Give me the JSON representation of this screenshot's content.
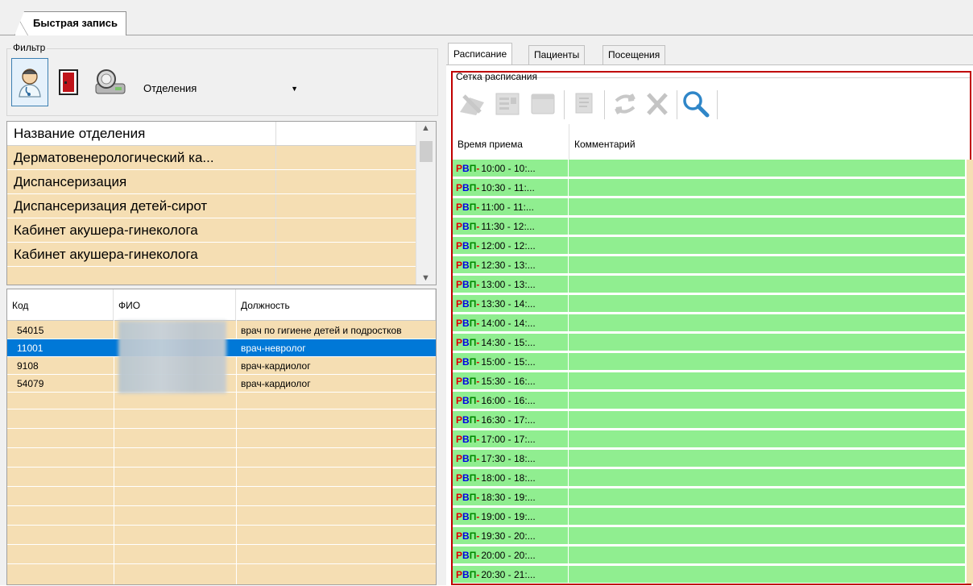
{
  "main_tab": {
    "label": "Быстрая запись"
  },
  "filter": {
    "legend": "Фильтр",
    "select_value": "Отделения",
    "buttons": [
      "doctor-icon",
      "door-icon",
      "scanner-icon"
    ]
  },
  "departments": {
    "header": "Название отделения",
    "rows": [
      "Дерматовенерологический ка...",
      "Диспансеризация",
      "Диспансеризация детей-сирот",
      "Кабинет акушера-гинеколога",
      "Кабинет акушера-гинеколога"
    ]
  },
  "doctors": {
    "headers": {
      "code": "Код",
      "fio": "ФИО",
      "position": "Должность"
    },
    "rows": [
      {
        "code": "54015",
        "position": "врач по гигиене детей и подростков"
      },
      {
        "code": "11001",
        "position": "врач-невролог",
        "selected": true
      },
      {
        "code": "9108",
        "position": "врач-кардиолог"
      },
      {
        "code": "54079",
        "position": "врач-кардиолог"
      }
    ]
  },
  "right_tabs": [
    "Расписание",
    "Пациенты",
    "Посещения"
  ],
  "schedule": {
    "legend": "Сетка расписания",
    "headers": {
      "time": "Время приема",
      "comment": "Комментарий"
    },
    "prefix": {
      "r": "Р",
      "v": "В",
      "p": "П",
      "dash": "-"
    },
    "times": [
      "10:00 - 10:...",
      "10:30 - 11:...",
      "11:00 - 11:...",
      "11:30 - 12:...",
      "12:00 - 12:...",
      "12:30 - 13:...",
      "13:00 - 13:...",
      "13:30 - 14:...",
      "14:00 - 14:...",
      "14:30 - 15:...",
      "15:00 - 15:...",
      "15:30 - 16:...",
      "16:00 - 16:...",
      "16:30 - 17:...",
      "17:00 - 17:...",
      "17:30 - 18:...",
      "18:00 - 18:...",
      "18:30 - 19:...",
      "19:00 - 19:...",
      "19:30 - 20:...",
      "20:00 - 20:...",
      "20:30 - 21:..."
    ]
  },
  "colors": {
    "free_slot": "#90ee90",
    "row_bg": "#f5deb3",
    "selection": "#0078d7",
    "highlight_border": "#c00000"
  }
}
